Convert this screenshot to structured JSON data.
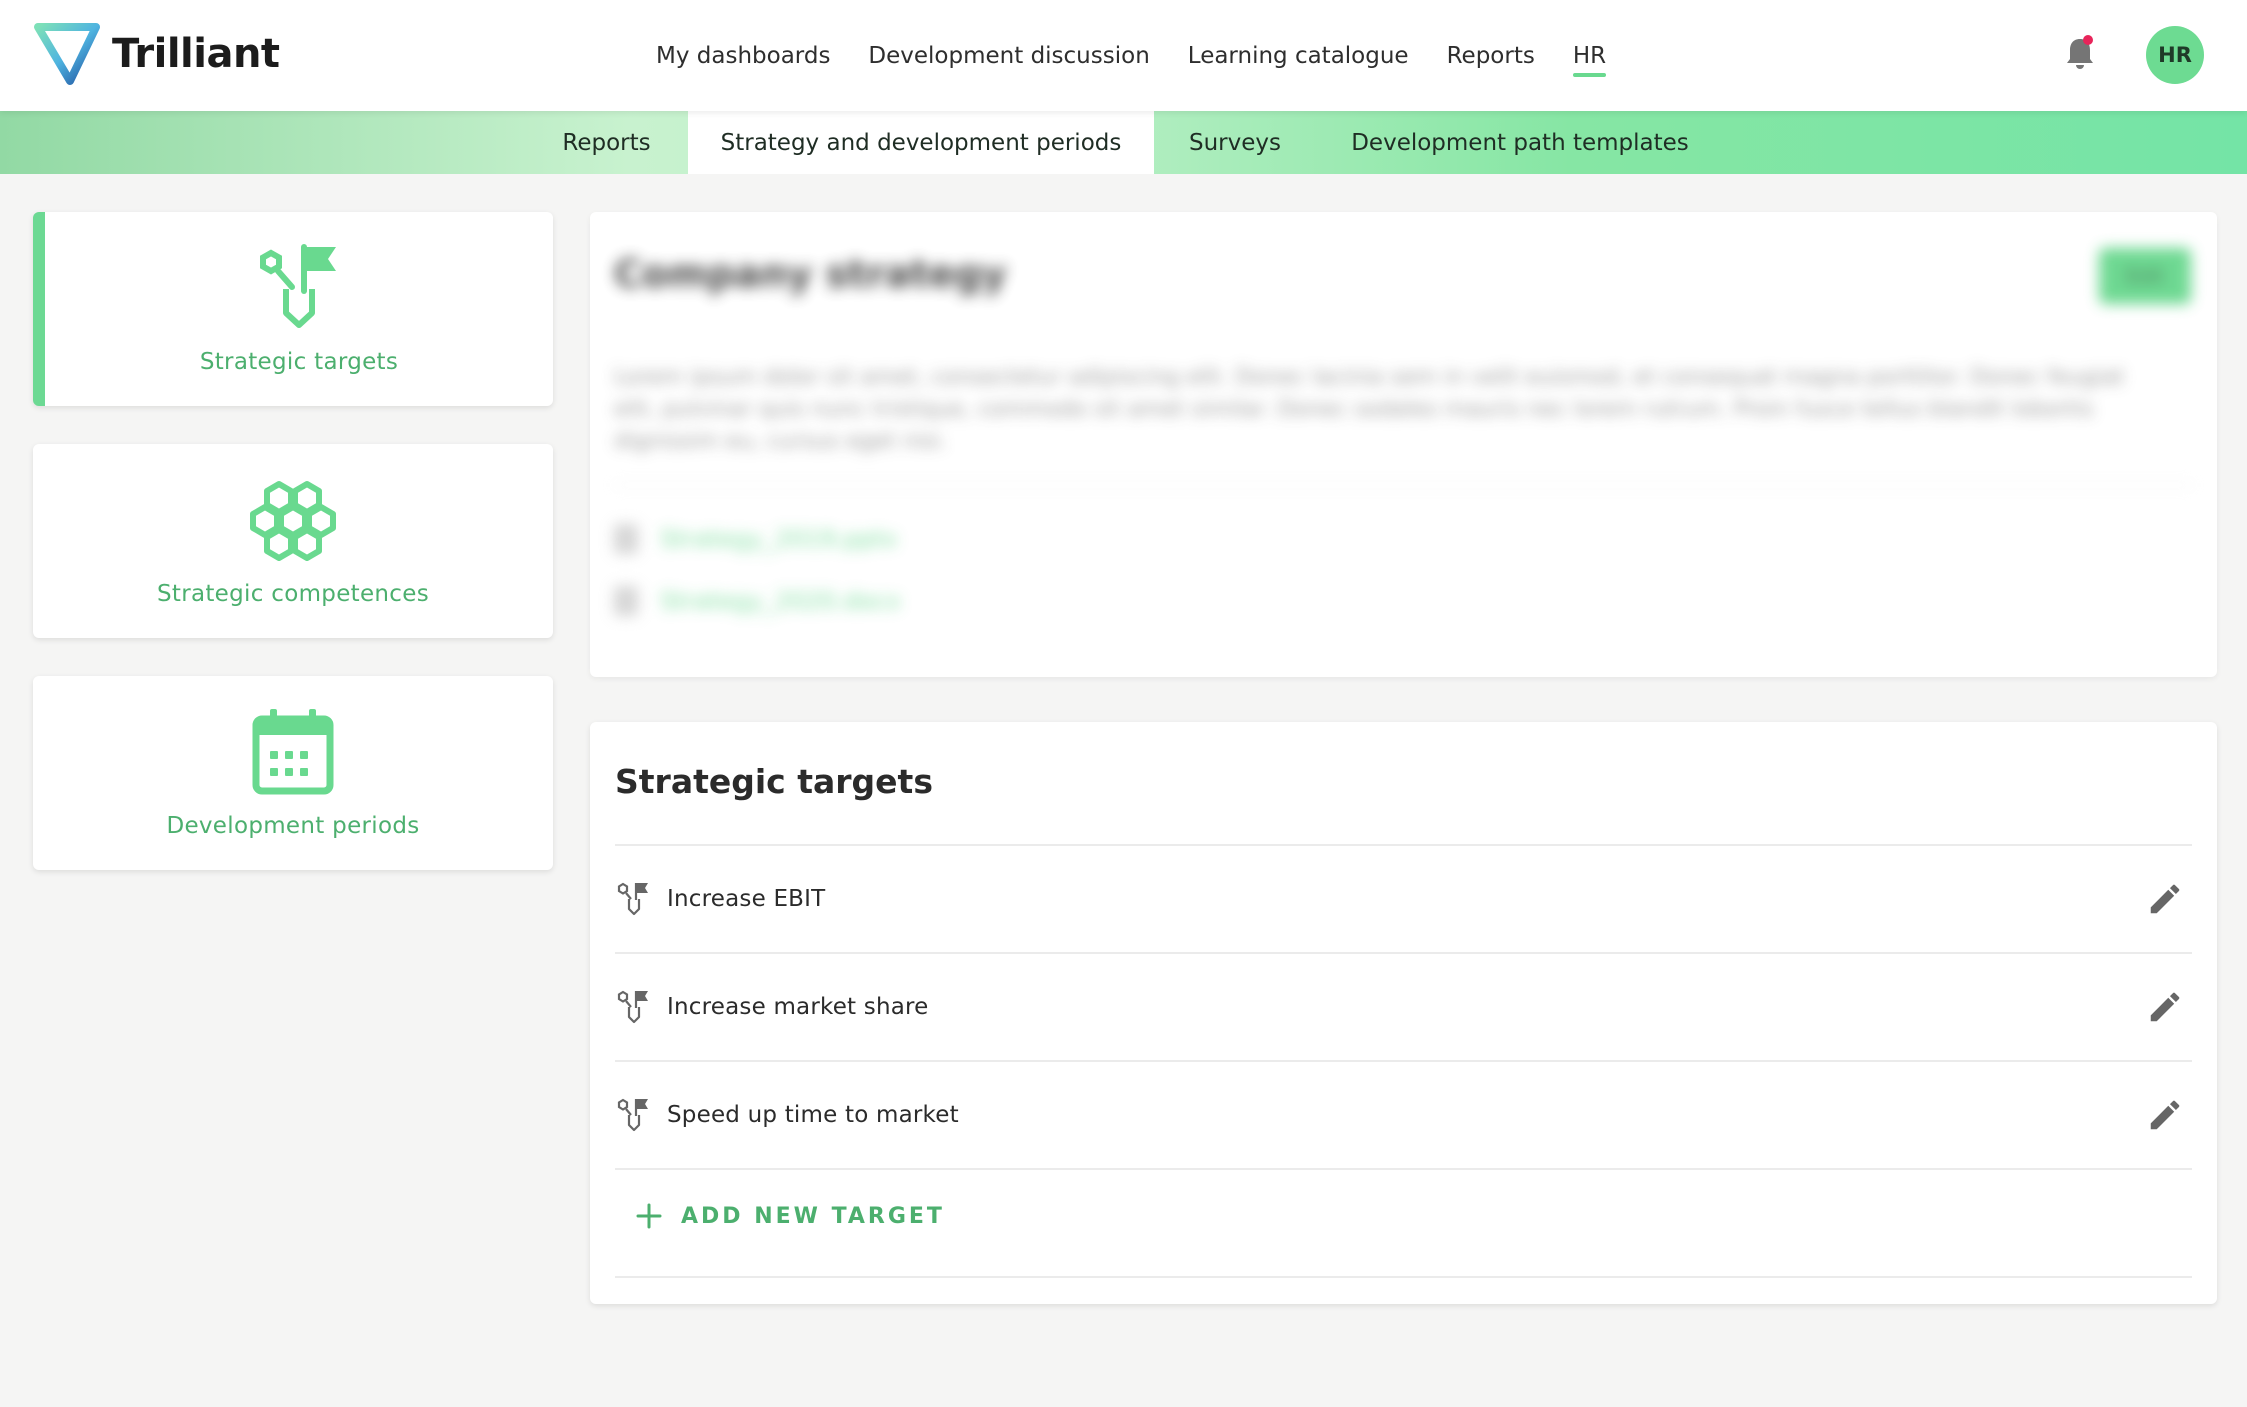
{
  "app": {
    "name": "Trilliant"
  },
  "header": {
    "nav": [
      {
        "label": "My dashboards",
        "active": false
      },
      {
        "label": "Development discussion",
        "active": false
      },
      {
        "label": "Learning catalogue",
        "active": false
      },
      {
        "label": "Reports",
        "active": false
      },
      {
        "label": "HR",
        "active": true
      }
    ],
    "notification_icon": "bell-icon",
    "avatar_initials": "HR"
  },
  "subnav": {
    "tabs": [
      {
        "label": "Reports",
        "active": false
      },
      {
        "label": "Strategy and development periods",
        "active": true
      },
      {
        "label": "Surveys",
        "active": false
      },
      {
        "label": "Development path templates",
        "active": false
      }
    ]
  },
  "sidebar": {
    "cards": [
      {
        "label": "Strategic targets",
        "icon": "strategic-target-icon",
        "active": true
      },
      {
        "label": "Strategic competences",
        "icon": "honeycomb-icon",
        "active": false
      },
      {
        "label": "Development periods",
        "icon": "calendar-icon",
        "active": false
      }
    ]
  },
  "strategy": {
    "title": "Company strategy",
    "edit_label": "Edit",
    "description": "Lorem ipsum dolor sit amet, consectetur adipiscing elit. Donec lacinia sem in velit euismod, et consequat magna porttitor. Donec feugiat elit, pulvinar quis nunc tristique, commodo sit amet similar. Donec sodales mauris nec lorem rutrum. Proin fusce tellus blandit lobortis dignissim eu, cursus eget nisi.",
    "attachments": [
      {
        "name": "Strategy_2019.pptx"
      },
      {
        "name": "Strategy_2020.docx"
      }
    ]
  },
  "targets": {
    "title": "Strategic targets",
    "items": [
      {
        "name": "Increase EBIT"
      },
      {
        "name": "Increase market share"
      },
      {
        "name": "Speed up time to market"
      }
    ],
    "add_label": "ADD NEW TARGET"
  },
  "colors": {
    "accent": "#69d98f",
    "accent_text": "#4caf6e",
    "avatar_bg": "#6ddb92",
    "notification_dot": "#e8245a"
  }
}
